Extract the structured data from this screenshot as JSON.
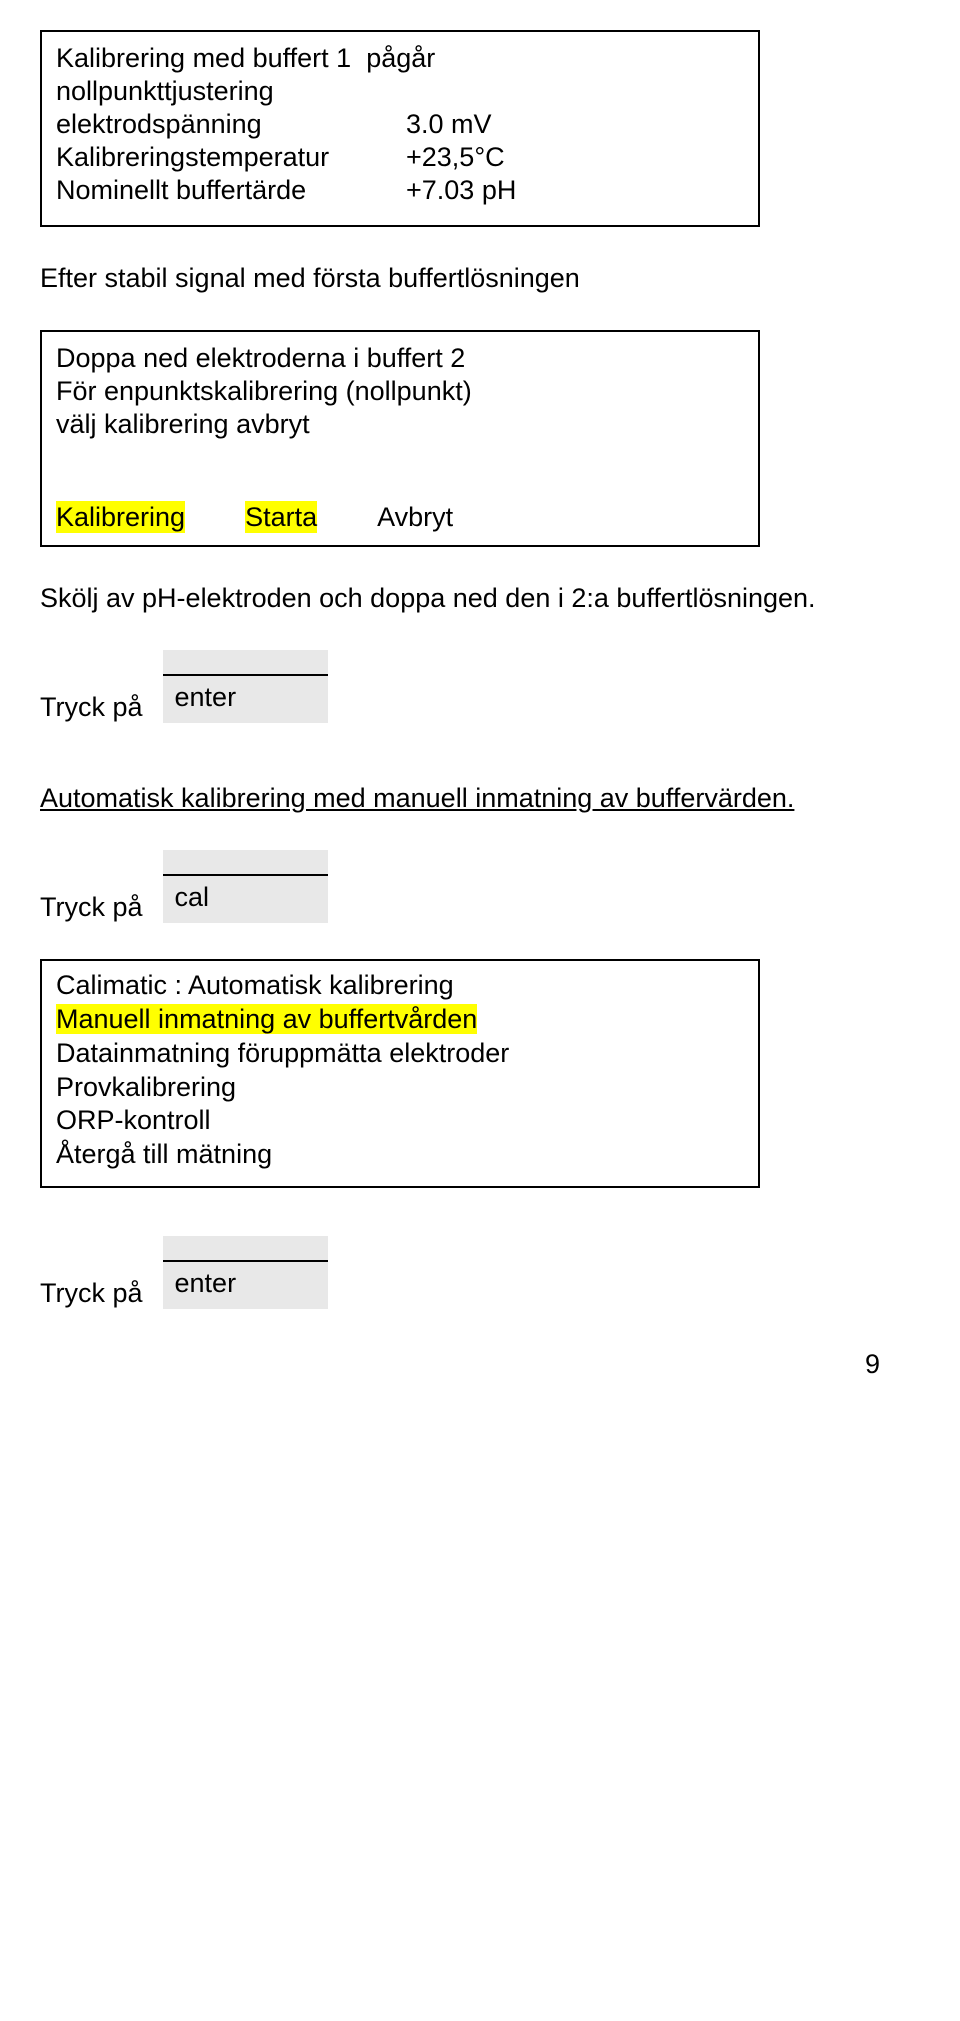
{
  "box1": {
    "title_part1": "Kalibrering med buffert 1",
    "title_part2": "pågår",
    "line2": "nollpunkttjustering",
    "row1_label": "elektrodspänning",
    "row1_value": "3.0 mV",
    "row2_label": "Kalibreringstemperatur",
    "row2_value": "+23,5°C",
    "row3_label": "Nominellt buffertärde",
    "row3_value": "+7.03 pH"
  },
  "para1": "Efter stabil signal med första buffertlösningen",
  "box2": {
    "line1": "Doppa ned elektroderna i buffert 2",
    "line2": "För enpunktskalibrering (nollpunkt)",
    "line3": "välj kalibrering avbryt",
    "action_label": "Kalibrering",
    "action_start": "Starta",
    "action_cancel": "Avbryt"
  },
  "para2": "Skölj av pH-elektroden och doppa ned den i 2:a buffertlösningen.",
  "press_label": "Tryck på",
  "key_enter": "enter",
  "heading_auto": "Automatisk kalibrering med manuell inmatning av buffervärden.",
  "key_cal": "cal",
  "menu": {
    "item1": "Calimatic : Automatisk kalibrering",
    "item2": "Manuell inmatning av buffertvården",
    "item3": "Datainmatning föruppmätta elektroder",
    "item4": "Provkalibrering",
    "item5": "ORP-kontroll",
    "item6": "Återgå till mätning"
  },
  "page_number": "9"
}
